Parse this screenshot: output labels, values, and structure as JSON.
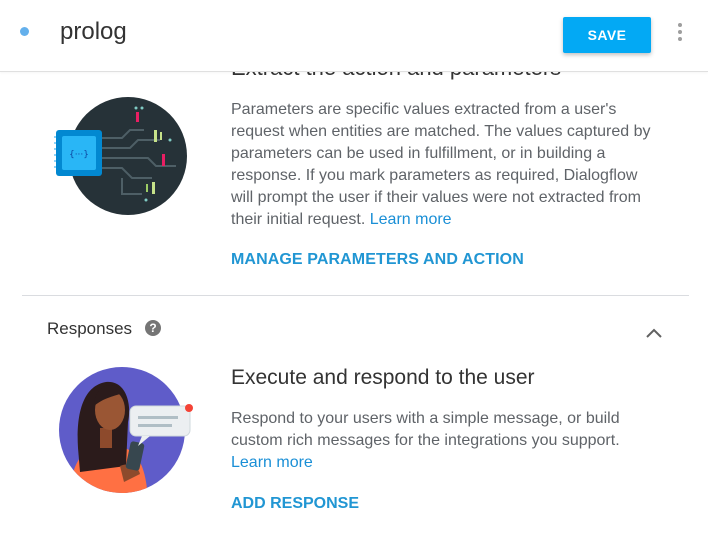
{
  "header": {
    "title": "prolog",
    "save_label": "SAVE"
  },
  "actions_section": {
    "heading": "Extract the action and parameters",
    "description": "Parameters are specific values extracted from a user's request when entities are matched. The values captured by parameters can be used in fulfillment, or in building a response. If you mark parameters as required, Dialogflow will prompt the user if their values were not extracted from their initial request.",
    "learn_more": "Learn more",
    "action_label": "MANAGE PARAMETERS AND ACTION",
    "chip_text": "{···}"
  },
  "responses_section": {
    "label": "Responses",
    "help_glyph": "?",
    "heading": "Execute and respond to the user",
    "description": "Respond to your users with a simple message, or build custom rich messages for the integrations you support.",
    "learn_more": "Learn more",
    "action_label": "ADD RESPONSE"
  },
  "icons": {
    "more": "more-vert-icon",
    "help": "help-icon",
    "collapse": "chevron-up-icon"
  },
  "colors": {
    "accent": "#03a9f4",
    "link": "#2196d3",
    "status_dot": "#64b0ec"
  }
}
